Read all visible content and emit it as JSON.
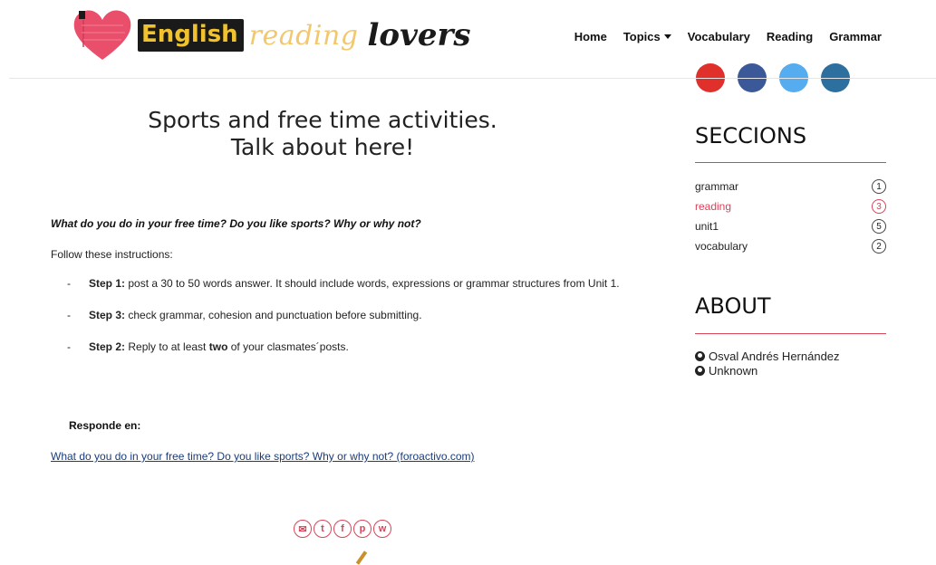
{
  "logo": {
    "word1": "English",
    "word2": "reading",
    "word3": "lovers"
  },
  "nav": {
    "home": "Home",
    "topics": "Topics",
    "vocabulary": "Vocabulary",
    "reading": "Reading",
    "grammar": "Grammar"
  },
  "post": {
    "title_line1": "Sports and free time activities.",
    "title_line2": "Talk about here!",
    "question": "What do you do in your free time? Do you like sports? Why or why not?",
    "instructions": "Follow these instructions:",
    "steps": [
      {
        "dash": "-",
        "label": "Step 1:",
        "text_a": " post a 30 to 50 words answer. It should include words, expressions or grammar structures from Unit 1.",
        "bold": "",
        "text_b": ""
      },
      {
        "dash": "-",
        "label": "Step 3:",
        "text_a": " check grammar, cohesion and punctuation before submitting.",
        "bold": "",
        "text_b": ""
      },
      {
        "dash": "-",
        "label": "Step 2:",
        "text_a": " Reply to at least ",
        "bold": "two",
        "text_b": " of your clasmates´posts."
      }
    ],
    "responde_label": "Responde en:",
    "link_text": "What do you do in your free time? Do you like sports? Why or why not? (foroactivo.com)"
  },
  "share": {
    "icons": [
      "email-icon",
      "twitter-icon",
      "facebook-icon",
      "pinterest-icon",
      "whatsapp-icon"
    ],
    "glyphs": [
      "✉",
      "t",
      "f",
      "p",
      "w"
    ],
    "color": "#d9445a"
  },
  "sidebar": {
    "sections_title": "SECCIONS",
    "sections": [
      {
        "label": "grammar",
        "count": "1",
        "active": false
      },
      {
        "label": "reading",
        "count": "3",
        "active": true
      },
      {
        "label": "unit1",
        "count": "5",
        "active": false
      },
      {
        "label": "vocabulary",
        "count": "2",
        "active": false
      }
    ],
    "about_title": "ABOUT",
    "authors": [
      "Osval Andrés Hernández",
      "Unknown"
    ],
    "accent": "#d9445a"
  },
  "social_colors": [
    "#e0302b",
    "#3b5998",
    "#55acee",
    "#2d6f9e"
  ]
}
